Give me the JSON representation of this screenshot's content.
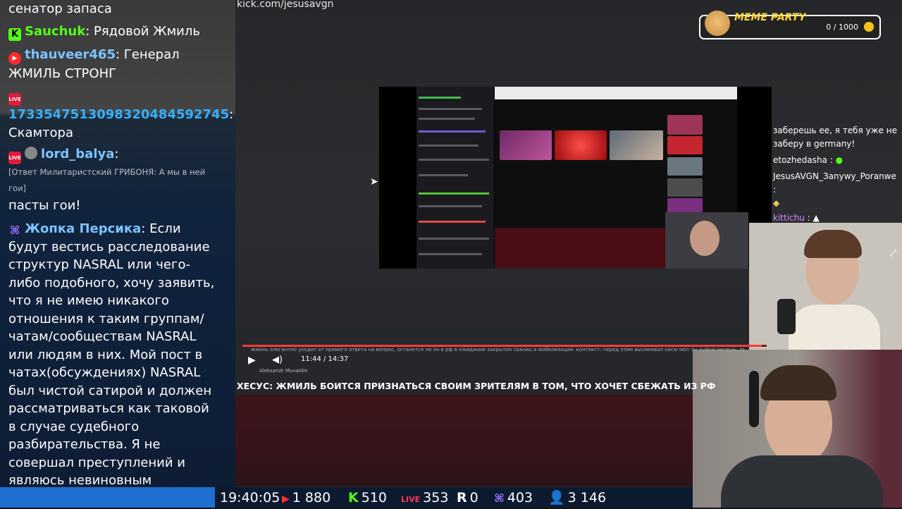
{
  "chat": {
    "messages": [
      {
        "text": "сенатор запаса"
      },
      {
        "badge": "K",
        "user": "Sauchuk",
        "user_color": "#53fc18",
        "text": "Рядовой Жмиль"
      },
      {
        "badge": "yt",
        "user": "thauveer465",
        "user_color": "#7cc3ff",
        "text": "Генерал ЖМИЛЬ СТРОНГ"
      },
      {
        "badge": "LIVE",
        "user": "1733547513098320484592745",
        "user_color": "#35b0ff",
        "text": "Скамтора"
      },
      {
        "badge": "LIVE",
        "user": "lord_balya",
        "user_color": "#7cc3ff",
        "reply": "[Ответ Милитаристский ГРИБОНЯ: А мы в ней гои]",
        "text": "пасты гои!"
      },
      {
        "badge": "tw",
        "user": "Жопка Персика",
        "user_color": "#7cc3ff",
        "text": "Если будут вестись расследование структур NASRAL или чего-либо подобного, хочу заявить, что я не имею никакого отношения к таким группам/чатам/сообществам NASRAL или людям в них. Мой пост в чатах(обсуждениях) NASRAL был чистой сатирой и должен рассматриваться как таковой в случае судебного разбирательства. Я не совершал преступлений и являюсь невиновным свидетелем NASRAL"
      }
    ]
  },
  "header": {
    "url": "kick.com/jesusavgn"
  },
  "widget": {
    "title": "MEME PARTY",
    "score": "0 / 1000",
    "colors": {
      "title": "#ffd43a"
    }
  },
  "right_chat": {
    "lines": [
      {
        "text": "заберешь ее, я тебя уже не заберу в germany!",
        "color": "#ffffff"
      },
      {
        "user": "etozhedasha",
        "text": ":",
        "color": "#ffffff"
      },
      {
        "user": "JesusAVGN_Заnywy_Poranwe",
        "text": ":",
        "color": "#ffffff"
      },
      {
        "user": "kittichu",
        "text": ":",
        "color": "#d58cff"
      }
    ]
  },
  "player": {
    "progress": 0.99,
    "time": "11:44 / 14:37",
    "author": "Aleksandr Muvaldin",
    "caption": "жмиль элегантно уходит от прямого ответа на вопрос, останется ли он в рф в ожидании закрытия границ и мобилизации. контекст: перед этим высмеивал хисю мол ты хуйню несешь, про все ограничения на выезд...",
    "headline": "ХЕСУС: ЖМИЛЬ БОИТСЯ ПРИЗНАТЬСЯ СВОИМ ЗРИТЕЛЯМ В ТОМ, ЧТО ХОЧЕТ СБЕЖАТЬ ИЗ РФ"
  },
  "stats": {
    "clock": "19:40:05",
    "youtube": "1 880",
    "kick": "510",
    "live": "353",
    "r": "0",
    "twitch": "403",
    "viewers": "3 146"
  },
  "icons": [
    "kick-icon",
    "youtube-icon",
    "live-icon",
    "twitch-icon",
    "viewers-icon",
    "play-icon",
    "volume-icon",
    "cursor-icon",
    "coin-icon"
  ]
}
